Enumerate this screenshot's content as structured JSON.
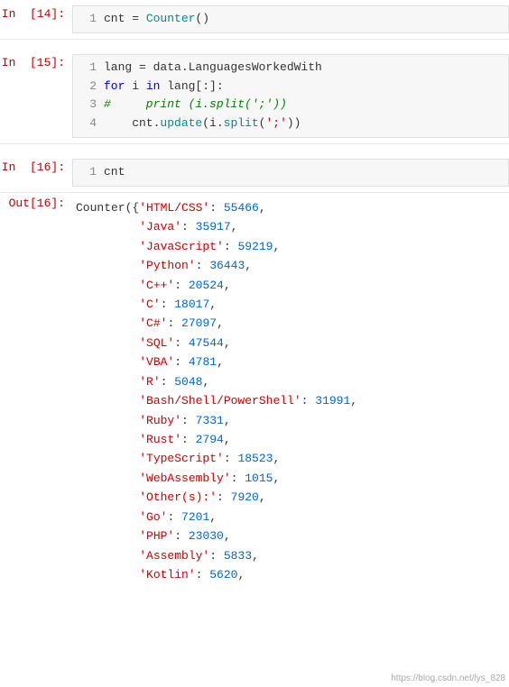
{
  "cells": [
    {
      "type": "input",
      "label": "In  [14]:",
      "lines": [
        {
          "num": "1",
          "code": "cnt = Counter()"
        }
      ]
    },
    {
      "type": "input",
      "label": "In  [15]:",
      "lines": [
        {
          "num": "1",
          "code": "lang = data.LanguagesWorkedWith"
        },
        {
          "num": "2",
          "code": "for i in lang[:]:"
        },
        {
          "num": "3",
          "code": "#    print (i.split(';'))"
        },
        {
          "num": "4",
          "code": "    cnt.update(i.split(';'))"
        }
      ]
    },
    {
      "type": "input",
      "label": "In  [16]:",
      "lines": [
        {
          "num": "1",
          "code": "cnt"
        }
      ]
    },
    {
      "type": "output",
      "label": "Out[16]:",
      "content": "Counter({'HTML/CSS': 55466,\n         'Java': 35917,\n         'JavaScript': 59219,\n         'Python': 36443,\n         'C++': 20524,\n         'C': 18017,\n         'C#': 27097,\n         'SQL': 47544,\n         'VBA': 4781,\n         'R': 5048,\n         'Bash/Shell/PowerShell': 31991,\n         'Ruby': 7331,\n         'Rust': 2794,\n         'TypeScript': 18523,\n         'WebAssembly': 1015,\n         'Other(s):': 7920,\n         'Go': 7201,\n         'PHP': 23030,\n         'Assembly': 5833,\n         'Kotlin': 5620,"
    }
  ],
  "watermark": "https://blog.csdn.net/lys_828"
}
